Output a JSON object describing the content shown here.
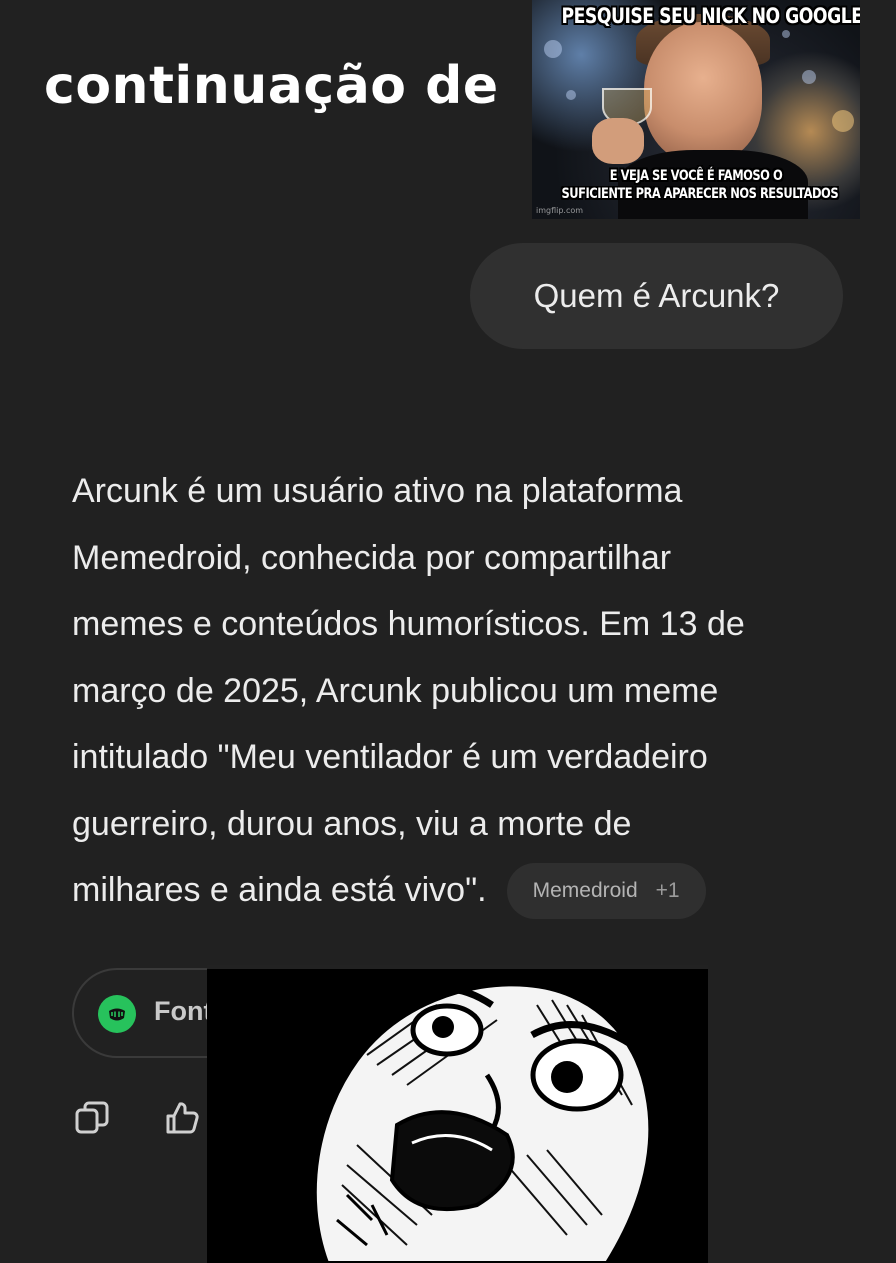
{
  "caption": {
    "title": "continuação de"
  },
  "meme_top": {
    "top_text": "PESQUISE SEU NICK NO GOOGLE",
    "bottom_text_line1": "E VEJA SE VOCÊ É FAMOSO O",
    "bottom_text_line2": "SUFICIENTE PRA APARECER NOS RESULTADOS",
    "watermark": "imgflip.com"
  },
  "chat": {
    "user_message": "Quem é Arcunk?",
    "answer_lines": [
      "Arcunk é um usuário ativo na plataforma",
      "Memedroid, conhecida por compartilhar",
      "memes e conteúdos humorísticos. Em 13 de",
      "março de 2025, Arcunk publicou um meme",
      "intitulado \"Meu ventilador é um verdadeiro",
      "guerreiro, durou anos, viu a morte de",
      "milhares e ainda está vivo\"."
    ],
    "source_chip": {
      "label": "Memedroid",
      "extra": "+1"
    },
    "sources_button": {
      "label": "Font"
    },
    "actions": [
      {
        "icon": "copy-icon"
      },
      {
        "icon": "thumbs-up-icon"
      }
    ]
  },
  "colors": {
    "background": "#212121",
    "bubble": "#303030",
    "text": "#ececec",
    "chip": "#2f2f2f",
    "sources_icon": "#27c25c"
  }
}
